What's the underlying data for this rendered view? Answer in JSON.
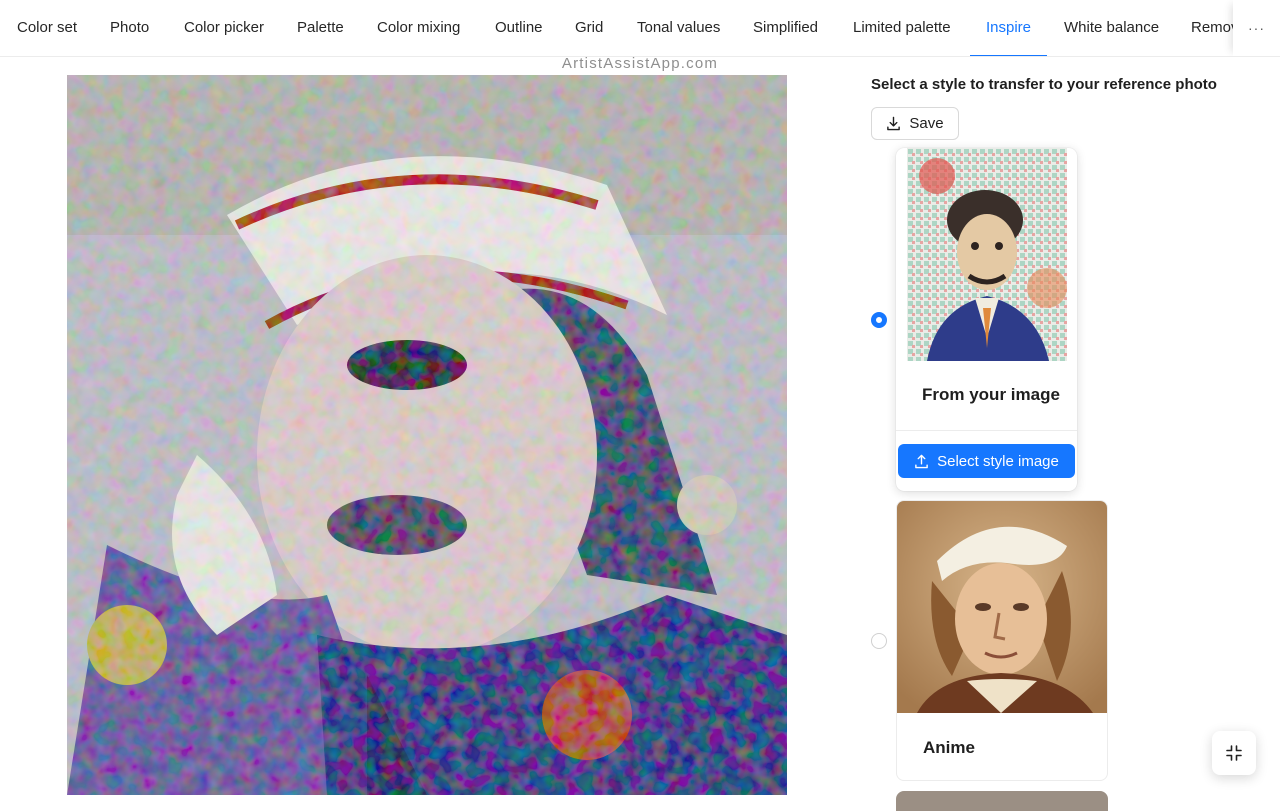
{
  "tabs": [
    {
      "label": "Color set",
      "active": false
    },
    {
      "label": "Photo",
      "active": false
    },
    {
      "label": "Color picker",
      "active": false
    },
    {
      "label": "Palette",
      "active": false
    },
    {
      "label": "Color mixing",
      "active": false
    },
    {
      "label": "Outline",
      "active": false
    },
    {
      "label": "Grid",
      "active": false
    },
    {
      "label": "Tonal values",
      "active": false
    },
    {
      "label": "Simplified",
      "active": false
    },
    {
      "label": "Limited palette",
      "active": false
    },
    {
      "label": "Inspire",
      "active": true
    },
    {
      "label": "White balance",
      "active": false
    },
    {
      "label": "Remove background",
      "active": false
    }
  ],
  "overflow_label": "···",
  "watermark": "ArtistAssistApp.com",
  "panel": {
    "title": "Select a style to transfer to your reference photo",
    "save_label": "Save"
  },
  "styles": [
    {
      "title": "From your image",
      "selected": true,
      "button_label": "Select style image"
    },
    {
      "title": "Anime",
      "selected": false
    }
  ],
  "colors": {
    "accent": "#1677ff",
    "text": "#1f1f1f",
    "border": "#d9d9d9"
  },
  "icons": {
    "save": "download-icon",
    "select_style": "upload-icon",
    "fullscreen_exit": "compress-icon"
  }
}
